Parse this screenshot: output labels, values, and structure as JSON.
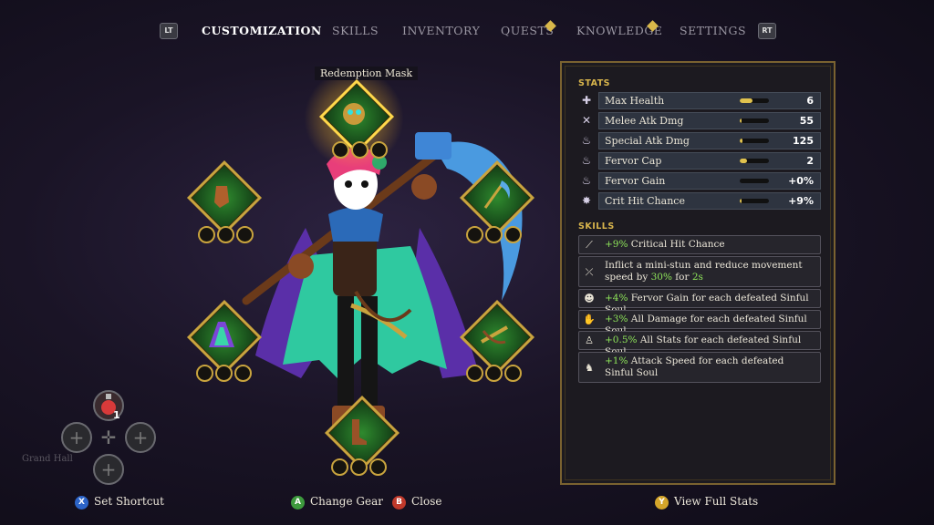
{
  "nav": {
    "left_shoulder": "LT",
    "right_shoulder": "RT",
    "tabs": [
      {
        "label": "CUSTOMIZATION",
        "active": true
      },
      {
        "label": "SKILLS",
        "active": false
      },
      {
        "label": "INVENTORY",
        "active": false
      },
      {
        "label": "QUESTS",
        "active": false,
        "badge": true
      },
      {
        "label": "KNOWLEDGE",
        "active": false,
        "badge": true
      },
      {
        "label": "SETTINGS",
        "active": false
      }
    ]
  },
  "gear": {
    "tooltip": "Redemption Mask",
    "slots": [
      {
        "slot": "head",
        "item_icon": "mask-icon",
        "highlighted": true
      },
      {
        "slot": "hands",
        "item_icon": "glove-icon"
      },
      {
        "slot": "weapon-main",
        "item_icon": "scythe-icon"
      },
      {
        "slot": "body",
        "item_icon": "robe-icon"
      },
      {
        "slot": "weapon-offhand",
        "item_icon": "crossbow-icon"
      },
      {
        "slot": "feet",
        "item_icon": "boots-icon"
      }
    ]
  },
  "quick_slots": {
    "potion_count": "1",
    "location": "Grand Hall"
  },
  "stats": {
    "title": "STATS",
    "rows": [
      {
        "icon": "health-icon",
        "label": "Max Health",
        "value": "6",
        "fill": 0.45
      },
      {
        "icon": "melee-icon",
        "label": "Melee Atk Dmg",
        "value": "55",
        "fill": 0.05
      },
      {
        "icon": "special-icon",
        "label": "Special Atk Dmg",
        "value": "125",
        "fill": 0.1
      },
      {
        "icon": "fervor-icon",
        "label": "Fervor Cap",
        "value": "2",
        "fill": 0.25
      },
      {
        "icon": "fervor-gain-icon",
        "label": "Fervor Gain",
        "value": "+0%",
        "fill": 0.0
      },
      {
        "icon": "crit-icon",
        "label": "Crit Hit Chance",
        "value": "+9%",
        "fill": 0.05
      }
    ]
  },
  "skills": {
    "title": "SKILLS",
    "rows": [
      {
        "icon": "scythe-skill-icon",
        "parts": [
          {
            "t": "+9%",
            "g": true
          },
          {
            "t": " Critical Hit Chance"
          }
        ]
      },
      {
        "icon": "crossbow-skill-icon",
        "parts": [
          {
            "t": "Inflict a mini-stun and reduce movement speed by "
          },
          {
            "t": "30%",
            "g": true
          },
          {
            "t": " for "
          },
          {
            "t": "2s",
            "g": true
          }
        ]
      },
      {
        "icon": "mask-skill-icon",
        "parts": [
          {
            "t": "+4%",
            "g": true
          },
          {
            "t": " Fervor Gain for each defeated Sinful Soul"
          }
        ]
      },
      {
        "icon": "glove-skill-icon",
        "parts": [
          {
            "t": "+3%",
            "g": true
          },
          {
            "t": " All Damage for each defeated Sinful Soul"
          }
        ]
      },
      {
        "icon": "robe-skill-icon",
        "parts": [
          {
            "t": "+0.5%",
            "g": true
          },
          {
            "t": " All Stats for each defeated Sinful Soul"
          }
        ]
      },
      {
        "icon": "boots-skill-icon",
        "parts": [
          {
            "t": "+1%",
            "g": true
          },
          {
            "t": " Attack Speed for each defeated Sinful Soul"
          }
        ]
      }
    ]
  },
  "footer": {
    "shortcut": {
      "button": "X",
      "label": "Set Shortcut",
      "color": "#2c64c8"
    },
    "change": {
      "button": "A",
      "label": "Change Gear",
      "color": "#3d9a3d"
    },
    "close": {
      "button": "B",
      "label": "Close",
      "color": "#c0392b"
    },
    "full": {
      "button": "Y",
      "label": "View Full Stats",
      "color": "#d4a52a"
    }
  }
}
